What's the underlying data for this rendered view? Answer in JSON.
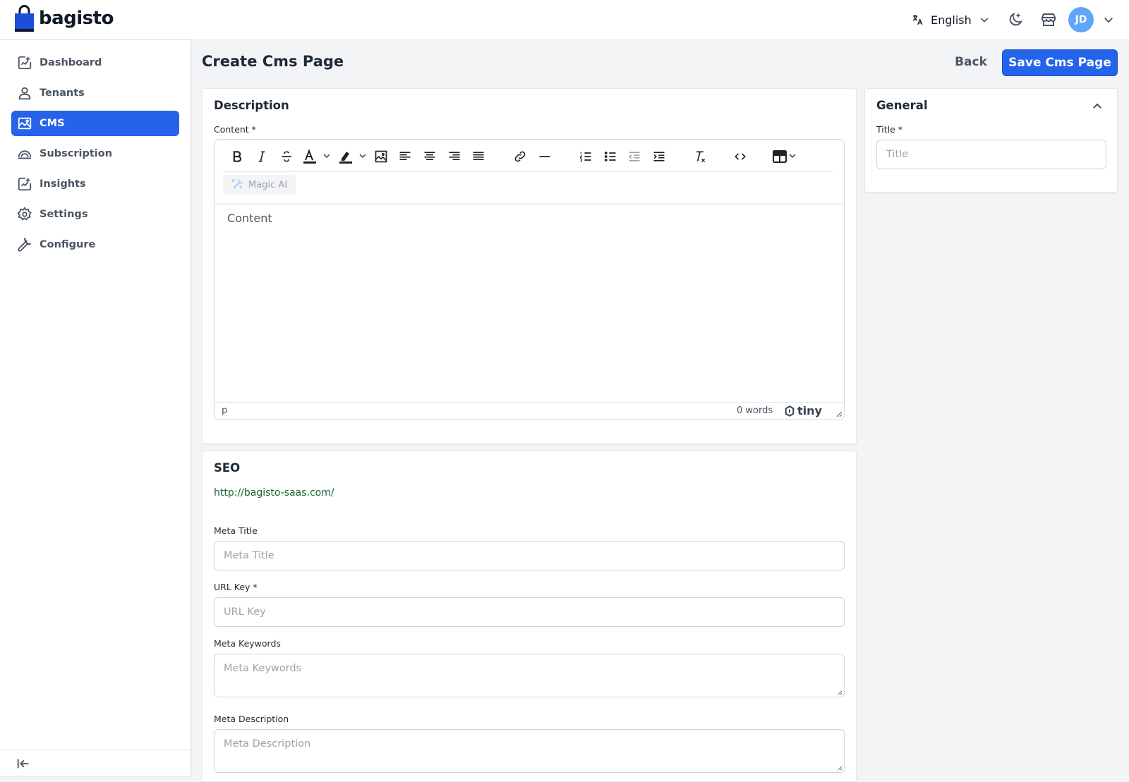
{
  "header": {
    "logo_text": "bagisto",
    "language": "English",
    "avatar_initials": "JD",
    "avatar_color": "#60a5fa"
  },
  "sidebar": {
    "items": [
      {
        "label": "Dashboard",
        "icon": "dashboard-icon"
      },
      {
        "label": "Tenants",
        "icon": "user-icon"
      },
      {
        "label": "CMS",
        "icon": "image-icon",
        "active": true
      },
      {
        "label": "Subscription",
        "icon": "subscription-icon"
      },
      {
        "label": "Insights",
        "icon": "chart-icon"
      },
      {
        "label": "Settings",
        "icon": "gear-icon"
      },
      {
        "label": "Configure",
        "icon": "wrench-icon"
      }
    ]
  },
  "page": {
    "title": "Create Cms Page",
    "back_label": "Back",
    "save_label": "Save Cms Page",
    "accent_color": "#2563eb"
  },
  "description": {
    "title": "Description",
    "content_label": "Content *",
    "magic_ai_label": "Magic AI",
    "content_placeholder": "Content",
    "status_path": "p",
    "word_count": "0 words",
    "brand": "tiny"
  },
  "general": {
    "title": "General",
    "title_label": "Title *",
    "title_placeholder": "Title"
  },
  "seo": {
    "title": "SEO",
    "url": "http://bagisto-saas.com/",
    "meta_title_label": "Meta Title",
    "meta_title_placeholder": "Meta Title",
    "url_key_label": "URL Key *",
    "url_key_placeholder": "URL Key",
    "meta_keywords_label": "Meta Keywords",
    "meta_keywords_placeholder": "Meta Keywords",
    "meta_description_label": "Meta Description",
    "meta_description_placeholder": "Meta Description"
  }
}
